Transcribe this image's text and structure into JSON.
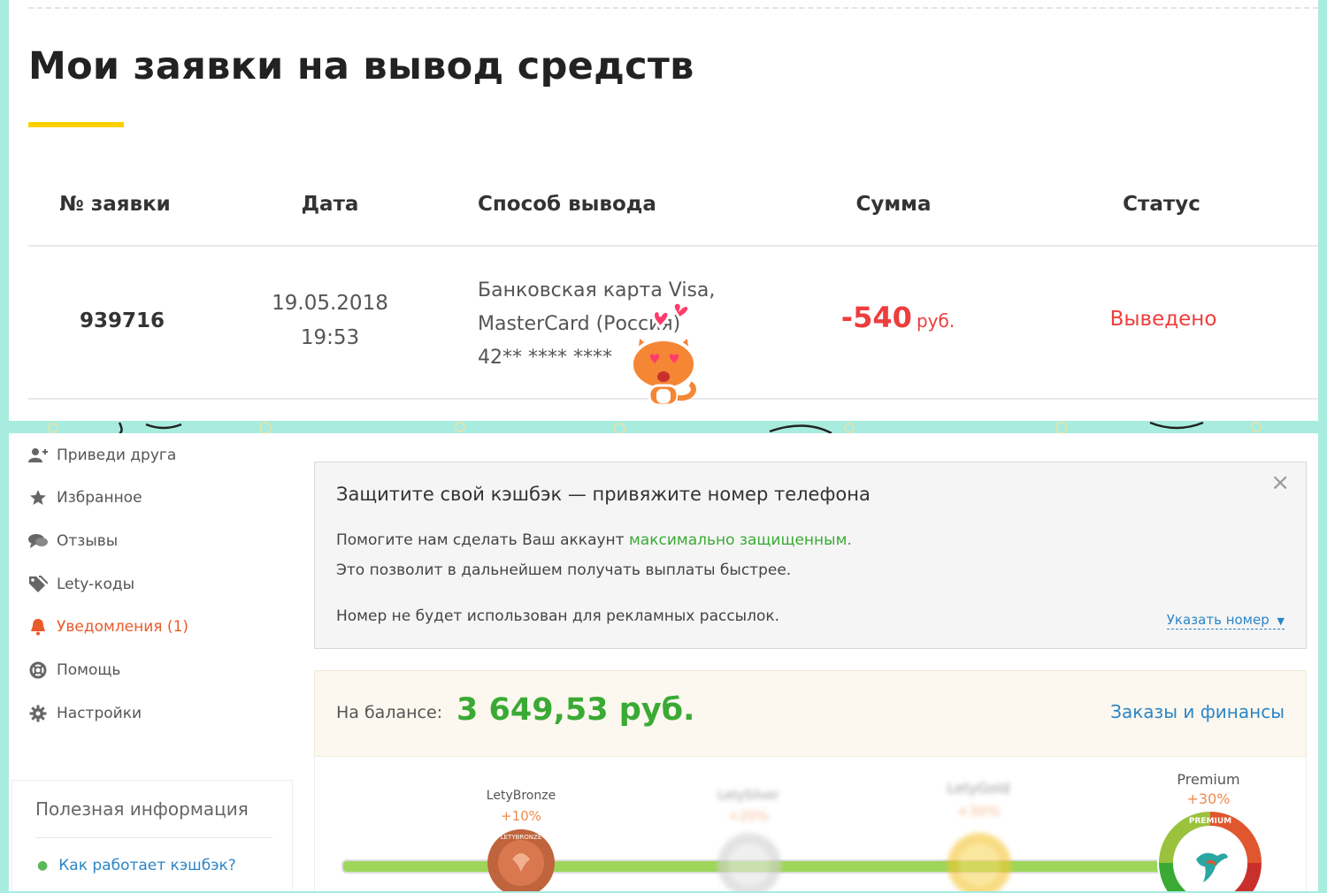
{
  "withdrawals": {
    "title": "Мои заявки на вывод средств",
    "headers": {
      "number": "№ заявки",
      "date": "Дата",
      "method": "Способ вывода",
      "sum": "Сумма",
      "status": "Статус"
    },
    "row": {
      "number": "939716",
      "date": "19.05.2018",
      "time": "19:53",
      "method_line1": "Банковская карта Visa,",
      "method_line2": "MasterCard (Россия)",
      "method_line3": "42** **** ****",
      "sum": "-540",
      "sum_unit": "руб.",
      "status": "Выведено"
    }
  },
  "sidebar": {
    "items": [
      {
        "label": "Приведи друга",
        "icon": "add-user-icon"
      },
      {
        "label": "Избранное",
        "icon": "star-icon"
      },
      {
        "label": "Отзывы",
        "icon": "chat-icon"
      },
      {
        "label": "Lety-коды",
        "icon": "tag-icon"
      },
      {
        "label": "Уведомления (1)",
        "icon": "bell-icon",
        "active": true
      },
      {
        "label": "Помощь",
        "icon": "lifebuoy-icon"
      },
      {
        "label": "Настройки",
        "icon": "gear-icon"
      }
    ],
    "info_title": "Полезная информация",
    "info_link": "Как работает кэшбэк?"
  },
  "phone_alert": {
    "title": "Защитите свой кэшбэк — привяжите номер телефона",
    "line1_prefix": "Помогите нам сделать Ваш аккаунт ",
    "line1_link": "максимально защищенным.",
    "line2": "Это позволит в дальнейшем получать выплаты быстрее.",
    "line3": "Номер не будет использован для рекламных рассылок.",
    "action": "Указать номер"
  },
  "balance": {
    "label": "На балансе:",
    "value": "3 649,53 руб.",
    "link": "Заказы и финансы"
  },
  "levels": [
    {
      "name": "LetyBronze",
      "bonus": "+10%"
    },
    {
      "name": "LetySilver",
      "bonus": "+20%"
    },
    {
      "name": "LetyGold",
      "bonus": "+30%"
    },
    {
      "name": "Premium",
      "bonus": "+30%"
    }
  ],
  "badges": {
    "bronze_text": "LETYBRONZE",
    "premium_text": "PREMIUM"
  },
  "colors": {
    "accent_yellow": "#fcd000",
    "red": "#ee3d3d",
    "green": "#3aaa35",
    "link_blue": "#2b85c6",
    "frame_mint": "#a8ece0"
  }
}
